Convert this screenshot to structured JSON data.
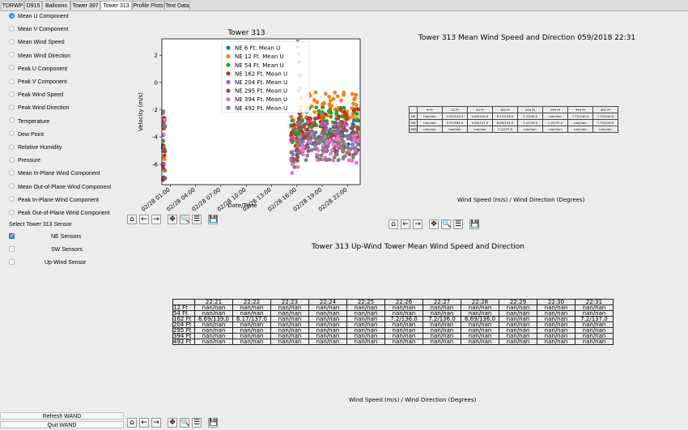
{
  "tabs": [
    {
      "label": "TDRWP"
    },
    {
      "label": "D915"
    },
    {
      "label": "Balloons"
    },
    {
      "label": "Tower 397"
    },
    {
      "label": "Tower 313",
      "active": true
    },
    {
      "label": "Profile Plots"
    },
    {
      "label": "Text Data"
    }
  ],
  "left": {
    "options": [
      {
        "label": "Mean U Component",
        "selected": true
      },
      {
        "label": "Mean V Component"
      },
      {
        "label": "Mean Wind Speed"
      },
      {
        "label": "Mean Wind Direction"
      },
      {
        "label": "Peak U Component"
      },
      {
        "label": "Peak V Component"
      },
      {
        "label": "Peak Wind Speed"
      },
      {
        "label": "Peak Wind Direction"
      },
      {
        "label": "Temperature"
      },
      {
        "label": "Dew Point"
      },
      {
        "label": "Relative Humidity"
      },
      {
        "label": "Pressure"
      },
      {
        "label": "Mean In-Plane Wind Component"
      },
      {
        "label": "Mean Out-of-Plane Wind Component"
      },
      {
        "label": "Peak In-Plane Wind Component"
      },
      {
        "label": "Peak Out-of-Plane Wind Component"
      }
    ],
    "sensor_heading": "Select Tower 313 Sensor",
    "sensors": [
      {
        "label": "NE Sensors",
        "checked": true
      },
      {
        "label": "SW Sensors",
        "checked": false
      },
      {
        "label": "Up-Wind Sensor",
        "checked": false
      }
    ],
    "refresh_label": "Refresh WAND",
    "quit_label": "Quit WAND"
  },
  "toolbar_icons": [
    "home-icon",
    "back-arrow-icon",
    "forward-arrow-icon",
    "pan-icon",
    "zoom-icon",
    "configure-icon",
    "save-icon"
  ],
  "toolbar_glyphs": [
    "⌂",
    "←",
    "→",
    "✥",
    "🔍",
    "☰",
    "💾"
  ],
  "chart_data": {
    "type": "scatter",
    "title": "Tower 313",
    "xlabel": "Date/Time",
    "ylabel": "Velocity (m/s)",
    "yticks": [
      2,
      0,
      -2,
      -4,
      -6
    ],
    "xticks": [
      "02/28 01:00",
      "02/28 04:00",
      "02/28 07:00",
      "02/28 10:00",
      "02/28 13:00",
      "02/28 16:00",
      "02/28 19:00",
      "02/28 22:00"
    ],
    "ylim": [
      -7.5,
      3.2
    ],
    "xlim": [
      0,
      23.5
    ],
    "series": [
      {
        "name": "NE 6 Ft.  Mean U",
        "color": "#1f77b4"
      },
      {
        "name": "NE 12 Ft.  Mean U",
        "color": "#ff7f0e"
      },
      {
        "name": "NE 54 Ft.  Mean U",
        "color": "#2ca02c"
      },
      {
        "name": "NE 162 Ft.  Mean U",
        "color": "#d62728"
      },
      {
        "name": "NE 204 Ft.  Mean U",
        "color": "#9467bd"
      },
      {
        "name": "NE 295 Ft.  Mean U",
        "color": "#8c564b"
      },
      {
        "name": "NE 394 Ft.  Mean U",
        "color": "#e377c2"
      },
      {
        "name": "NE 492 Ft.  Mean U",
        "color": "#7f7f7f"
      }
    ],
    "legend_position": "top-center"
  },
  "table1": {
    "title": "Tower 313 Mean Wind Speed and Direction 059/2018 22:31",
    "header": [
      "",
      "6 Ft",
      "12 Ft",
      "54 Ft",
      "162 Ft",
      "204 Ft",
      "295 Ft",
      "394 Ft",
      "492 Ft"
    ],
    "rows": [
      [
        "NE",
        "nan/nan",
        "2.57/142.0",
        "4.63/140.0",
        "6.17/139.0",
        "7.2/140.0",
        "nan/nan",
        "7.72/140.0",
        "7.72/140.0"
      ],
      [
        "SW",
        "nan/nan",
        "2.57/184.0",
        "4.63/127.0",
        "6.69/134.0",
        "7.2/130.0",
        "7.2/137.0",
        "nan/nan",
        "7.72/129.0"
      ],
      [
        "UWS",
        "nan/nan",
        "nan/nan",
        "nan/nan",
        "7.2/137.0",
        "nan/nan",
        "nan/nan",
        "nan/nan",
        "nan/nan"
      ]
    ],
    "footer": "Wind Speed (m/s) / Wind Direction (Degrees)"
  },
  "table2": {
    "title": "Tower 313 Up-Wind Tower Mean Wind Speed and Direction",
    "header": [
      "",
      "22:21",
      "22:22",
      "22:23",
      "22:24",
      "22:25",
      "22:26",
      "22:27",
      "22:28",
      "22:29",
      "22:30",
      "22:31"
    ],
    "rows": [
      [
        "12 Ft",
        "nan/nan",
        "nan/nan",
        "nan/nan",
        "nan/nan",
        "nan/nan",
        "nan/nan",
        "nan/nan",
        "nan/nan",
        "nan/nan",
        "nan/nan",
        "nan/nan"
      ],
      [
        "54 Ft",
        "nan/nan",
        "nan/nan",
        "nan/nan",
        "nan/nan",
        "nan/nan",
        "nan/nan",
        "nan/nan",
        "nan/nan",
        "nan/nan",
        "nan/nan",
        "nan/nan"
      ],
      [
        "162 Ft",
        "6.69/139.0",
        "6.17/137.0",
        "nan/nan",
        "nan/nan",
        "nan/nan",
        "7.2/136.0",
        "7.2/136.0",
        "6.69/136.0",
        "nan/nan",
        "nan/nan",
        "7.2/137.0"
      ],
      [
        "204 Ft",
        "nan/nan",
        "nan/nan",
        "nan/nan",
        "nan/nan",
        "nan/nan",
        "nan/nan",
        "nan/nan",
        "nan/nan",
        "nan/nan",
        "nan/nan",
        "nan/nan"
      ],
      [
        "295 Ft",
        "nan/nan",
        "nan/nan",
        "nan/nan",
        "nan/nan",
        "nan/nan",
        "nan/nan",
        "nan/nan",
        "nan/nan",
        "nan/nan",
        "nan/nan",
        "nan/nan"
      ],
      [
        "394 Ft",
        "nan/nan",
        "nan/nan",
        "nan/nan",
        "nan/nan",
        "nan/nan",
        "nan/nan",
        "nan/nan",
        "nan/nan",
        "nan/nan",
        "nan/nan",
        "nan/nan"
      ],
      [
        "492 Ft",
        "nan/nan",
        "nan/nan",
        "nan/nan",
        "nan/nan",
        "nan/nan",
        "nan/nan",
        "nan/nan",
        "nan/nan",
        "nan/nan",
        "nan/nan",
        "nan/nan"
      ]
    ],
    "footer": "Wind Speed (m/s) / Wind Direction (Degrees)"
  }
}
